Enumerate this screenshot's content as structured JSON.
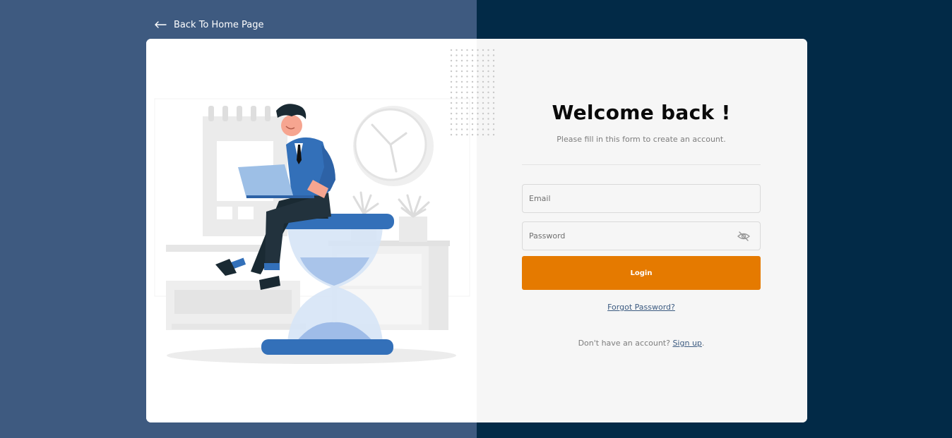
{
  "nav": {
    "back_label": "Back To Home Page"
  },
  "form": {
    "title": "Welcome back !",
    "subtitle": "Please fill in this form to create an account.",
    "email_placeholder": "Email",
    "password_placeholder": "Password",
    "login_label": "Login",
    "forgot_label": "Forgot Password?",
    "signup_prompt": "Don't have an account?",
    "signup_link": "Sign up",
    "signup_suffix": "."
  },
  "icons": {
    "back": "arrow-left-icon",
    "password_toggle": "eye-slash-icon"
  },
  "colors": {
    "left_bg": "#3e5a80",
    "right_bg": "#022a47",
    "accent": "#e57a00",
    "link": "#3b5a80",
    "illustration_blue": "#3370b9"
  }
}
